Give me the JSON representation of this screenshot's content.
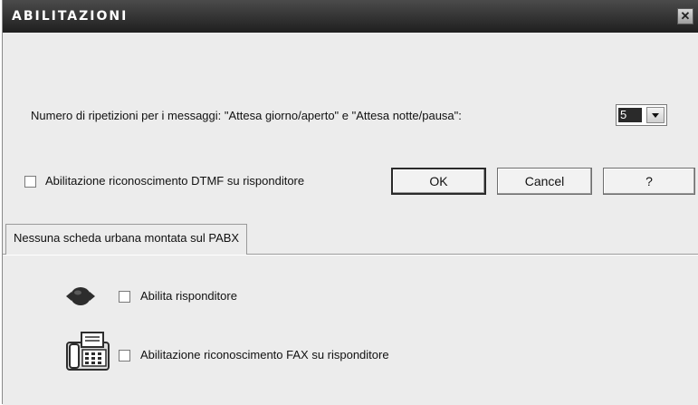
{
  "window": {
    "title": "Abilitazioni",
    "close_icon": "close-icon"
  },
  "repetitions": {
    "label": "Numero di ripetizioni per i messaggi: \"Attesa giorno/aperto\" e \"Attesa notte/pausa\":",
    "selected_value": "5"
  },
  "dtmf": {
    "label": "Abilitazione riconoscimento DTMF su risponditore",
    "checked": false
  },
  "buttons": {
    "ok": "OK",
    "cancel": "Cancel",
    "help": "?"
  },
  "tabs": [
    {
      "label": "Nessuna scheda urbana montata sul PABX"
    }
  ],
  "panel": {
    "answering": {
      "label": "Abilita risponditore",
      "icon": "answering-machine-icon",
      "checked": false
    },
    "fax": {
      "label": "Abilitazione riconoscimento FAX su risponditore",
      "icon": "fax-machine-icon",
      "checked": false
    }
  }
}
